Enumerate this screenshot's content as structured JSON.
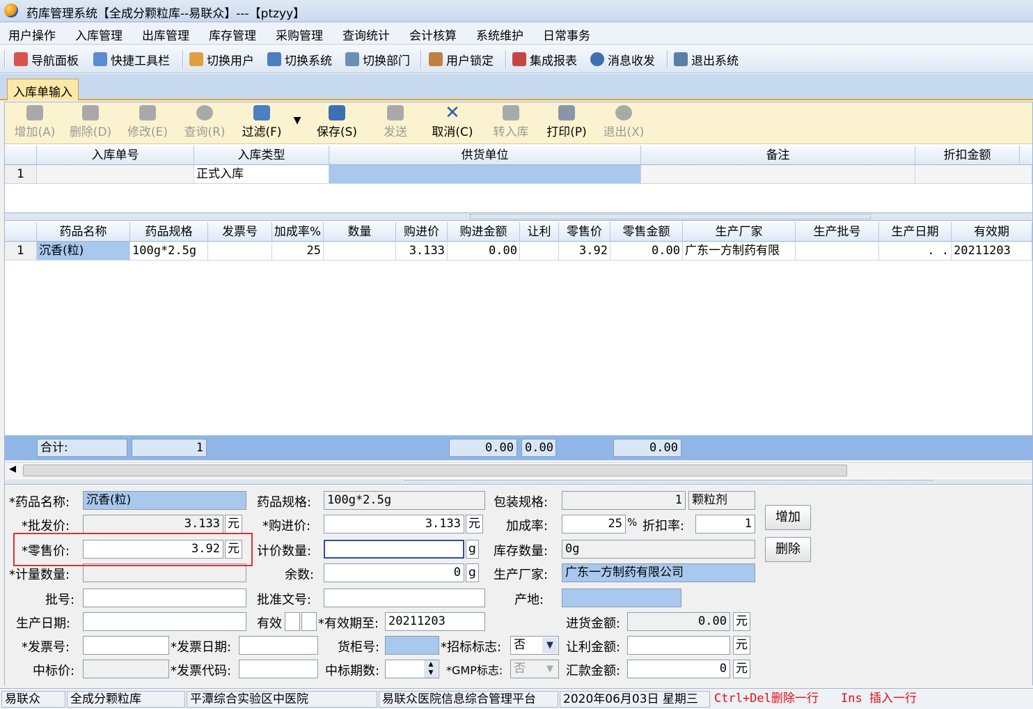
{
  "window": {
    "title": "药库管理系统【全成分颗粒库--易联众】---【ptzyy】"
  },
  "menu": [
    "用户操作",
    "入库管理",
    "出库管理",
    "库存管理",
    "采购管理",
    "查询统计",
    "会计核算",
    "系统维护",
    "日常事务"
  ],
  "toolbar": [
    "导航面板",
    "快捷工具栏",
    "切换用户",
    "切换系统",
    "切换部门",
    "用户锁定",
    "集成报表",
    "消息收发",
    "退出系统"
  ],
  "tab": "入库单输入",
  "ops": [
    {
      "label": "增加(A)",
      "enabled": false
    },
    {
      "label": "删除(D)",
      "enabled": false
    },
    {
      "label": "修改(E)",
      "enabled": false
    },
    {
      "label": "查询(R)",
      "enabled": false
    },
    {
      "label": "过滤(F)",
      "enabled": true
    },
    {
      "label": "保存(S)",
      "enabled": true
    },
    {
      "label": "发送",
      "enabled": false
    },
    {
      "label": "取消(C)",
      "enabled": true
    },
    {
      "label": "转入库",
      "enabled": false
    },
    {
      "label": "打印(P)",
      "enabled": true
    },
    {
      "label": "退出(X)",
      "enabled": false
    }
  ],
  "header_grid": {
    "columns": [
      "入库单号",
      "入库类型",
      "供货单位",
      "备注",
      "折扣金额"
    ],
    "rows": [
      {
        "idx": "1",
        "no": "",
        "type": "正式入库",
        "supplier": "",
        "note": "",
        "discount": ""
      }
    ]
  },
  "detail_grid": {
    "columns": [
      "药品名称",
      "药品规格",
      "发票号",
      "加成率%",
      "数量",
      "购进价",
      "购进金额",
      "让利",
      "零售价",
      "零售金额",
      "生产厂家",
      "生产批号",
      "生产日期",
      "有效期"
    ],
    "rows": [
      {
        "idx": "1",
        "name": "沉香(粒)",
        "spec": "100g*2.5g",
        "invoice": "",
        "markup": "25",
        "qty": "",
        "price": "3.133",
        "amount": "0.00",
        "discount": "",
        "retail": "3.92",
        "retail_amount": "0.00",
        "maker": "广东一方制药有限",
        "batch": "",
        "prod_date": ". .",
        "expiry": "20211203"
      }
    ]
  },
  "summary": {
    "label": "合计:",
    "count": "1",
    "amount": "0.00",
    "discount": "0.00",
    "retail_amount": "0.00"
  },
  "form": {
    "drug_name_label": "*药品名称:",
    "drug_name": "沉香(粒)",
    "spec_label": "药品规格:",
    "spec": "100g*2.5g",
    "pack_label": "包装规格:",
    "pack_qty": "1",
    "pack_unit": "颗粒剂",
    "wholesale_label": "*批发价:",
    "wholesale": "3.133",
    "purchase_label": "*购进价:",
    "purchase": "3.133",
    "markup_label": "加成率:",
    "markup": "25",
    "markup_unit": "%",
    "discount_rate_label": "折扣率:",
    "discount_rate": "1",
    "retail_label": "*零售价:",
    "retail": "3.92",
    "pricing_qty_label": "计价数量:",
    "pricing_qty": "",
    "g": "g",
    "stock_label": "库存数量:",
    "stock": "0g",
    "measure_label": "*计量数量:",
    "measure": "",
    "remain_label": "余数:",
    "remain": "0",
    "maker_label": "生产厂家:",
    "maker": "广东一方制药有限公司",
    "batch_label": "批号:",
    "batch": "",
    "approval_label": "批准文号:",
    "approval": "",
    "origin_label": "产地:",
    "origin": "",
    "prod_date_label": "生产日期:",
    "prod_date": "",
    "valid_label": "有效",
    "valid_to_label": "*有效期至:",
    "valid_to": "20211203",
    "in_amount_label": "进货金额:",
    "in_amount": "0.00",
    "invoice_no_label": "*发票号:",
    "invoice_no": "",
    "invoice_date_label": "*发票日期:",
    "invoice_date": "",
    "cabinet_label": "货柜号:",
    "cabinet": "",
    "bid_flag_label": "*招标标志:",
    "bid_flag": "否",
    "rebate_label": "让利金额:",
    "rebate": "",
    "bid_price_label": "中标价:",
    "bid_price": "",
    "invoice_code_label": "*发票代码:",
    "invoice_code": "",
    "bid_period_label": "中标期数:",
    "bid_period": "",
    "gmp_label": "*GMP标志:",
    "gmp": "否",
    "remit_label": "汇款金额:",
    "remit": "0",
    "yuan": "元",
    "add_btn": "增加",
    "del_btn": "删除"
  },
  "status": [
    "易联众",
    "全成分颗粒库",
    "平潭综合实验区中医院",
    "易联众医院信息综合管理平台",
    "2020年06月03日 星期三",
    "Ctrl+Del删除一行",
    "Ins 插入一行"
  ],
  "colors": {
    "accent": "#e8a317",
    "grid_header": "#dfe9f5",
    "selected": "#a8c8ee",
    "highlight": "#e03030"
  }
}
